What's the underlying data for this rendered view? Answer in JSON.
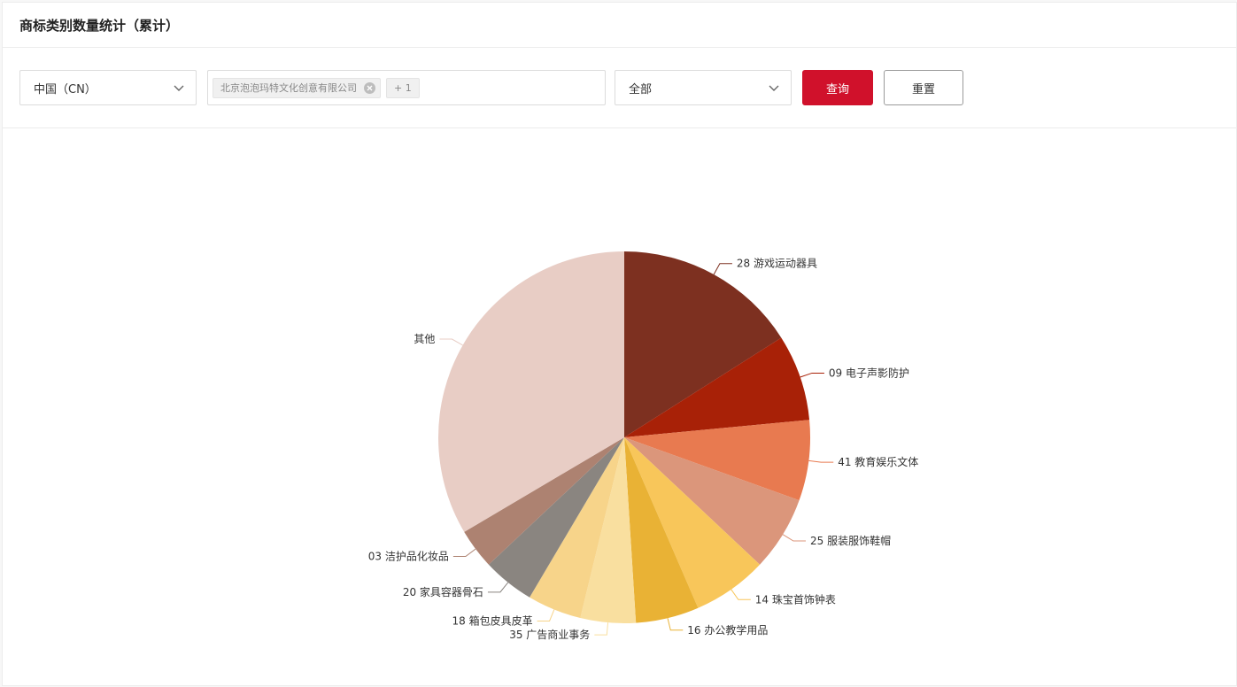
{
  "header": {
    "title": "商标类别数量统计（累计）"
  },
  "filters": {
    "country": {
      "value": "中国（CN）"
    },
    "applicants": {
      "tags": [
        {
          "label": "北京泡泡玛特文化创意有限公司"
        }
      ],
      "more_label": "+ 1"
    },
    "category": {
      "value": "全部"
    },
    "query_label": "查询",
    "reset_label": "重置"
  },
  "chart_data": {
    "type": "pie",
    "title": "",
    "start_angle": 90,
    "direction": "clockwise",
    "slices": [
      {
        "label": "28 游戏运动器具",
        "value": 16.0,
        "color": "#7d3020"
      },
      {
        "label": "09 电子声影防护",
        "value": 7.5,
        "color": "#a82107"
      },
      {
        "label": "41 教育娱乐文体",
        "value": 7.0,
        "color": "#e87a50"
      },
      {
        "label": "25 服装服饰鞋帽",
        "value": 6.5,
        "color": "#db967b"
      },
      {
        "label": "14 珠宝首饰钟表",
        "value": 6.5,
        "color": "#f8c65a"
      },
      {
        "label": "16 办公教学用品",
        "value": 5.5,
        "color": "#e9b235"
      },
      {
        "label": "35  广告商业事务",
        "value": 4.8,
        "color": "#f9df9f"
      },
      {
        "label": "18 箱包皮具皮革",
        "value": 4.7,
        "color": "#f7d48a"
      },
      {
        "label": "20 家具容器骨石",
        "value": 4.5,
        "color": "#8a8580"
      },
      {
        "label": "03 洁护品化妆品",
        "value": 3.5,
        "color": "#ad8271"
      },
      {
        "label": "其他",
        "value": 33.5,
        "color": "#e8cdc5"
      }
    ]
  }
}
